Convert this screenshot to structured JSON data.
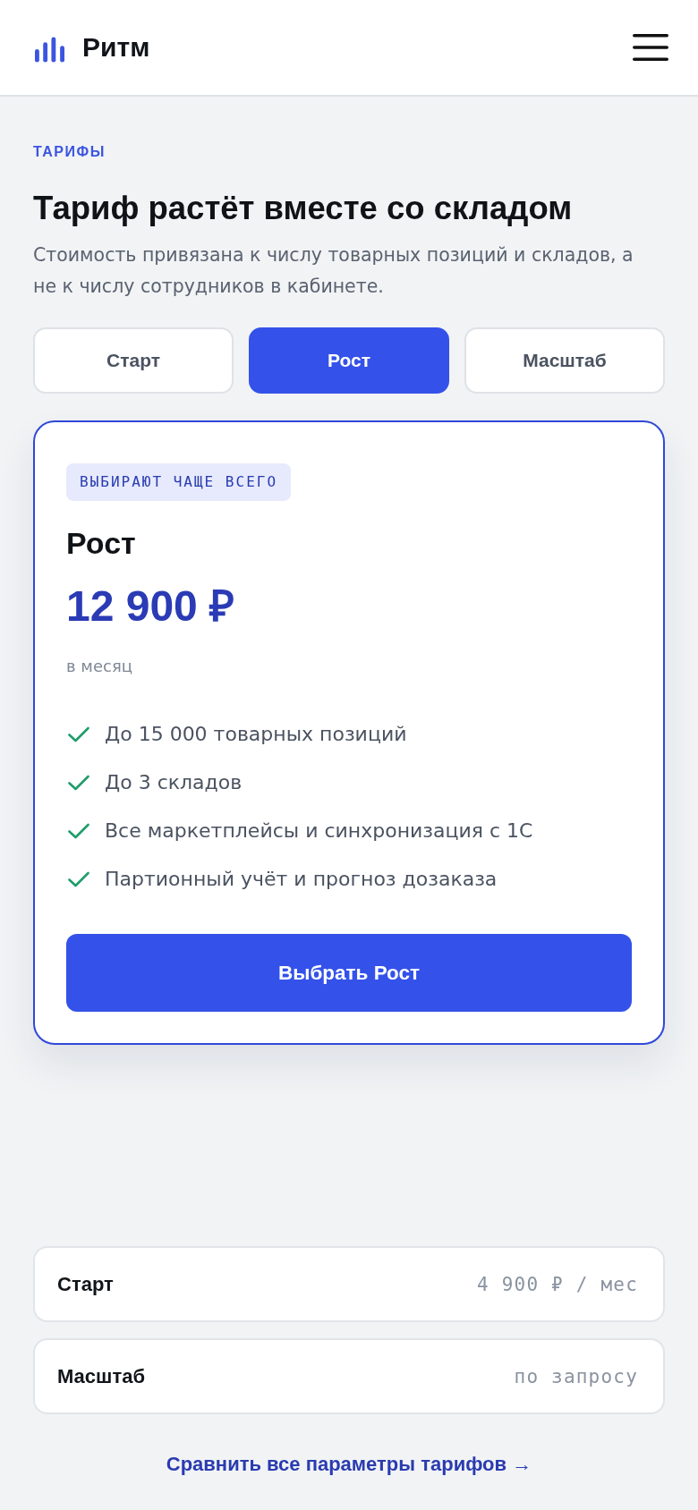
{
  "header": {
    "brand": "Ритм"
  },
  "intro": {
    "eyebrow": "ТАРИФЫ",
    "title": "Тариф растёт вместе со складом",
    "subtitle": "Стоимость привязана к числу товарных позиций и складов, а не к числу сотрудников в кабинете."
  },
  "tabs": [
    {
      "label": "Старт",
      "selected": false
    },
    {
      "label": "Рост",
      "selected": true
    },
    {
      "label": "Масштаб",
      "selected": false
    }
  ],
  "plan_card": {
    "badge": "ВЫБИРАЮТ ЧАЩЕ ВСЕГО",
    "name": "Рост",
    "price": "12 900 ₽",
    "period": "в месяц",
    "features": [
      "До 15 000 товарных позиций",
      "До 3 складов",
      "Все маркетплейсы и синхронизация с 1С",
      "Партионный учёт и прогноз дозаказа"
    ],
    "button": "Выбрать Рост"
  },
  "other_plans": [
    {
      "name": "Старт",
      "price": "4 900 ₽ / мес"
    },
    {
      "name": "Масштаб",
      "price": "по запросу"
    }
  ],
  "compare_link": "Сравнить все параметры тарифов →"
}
